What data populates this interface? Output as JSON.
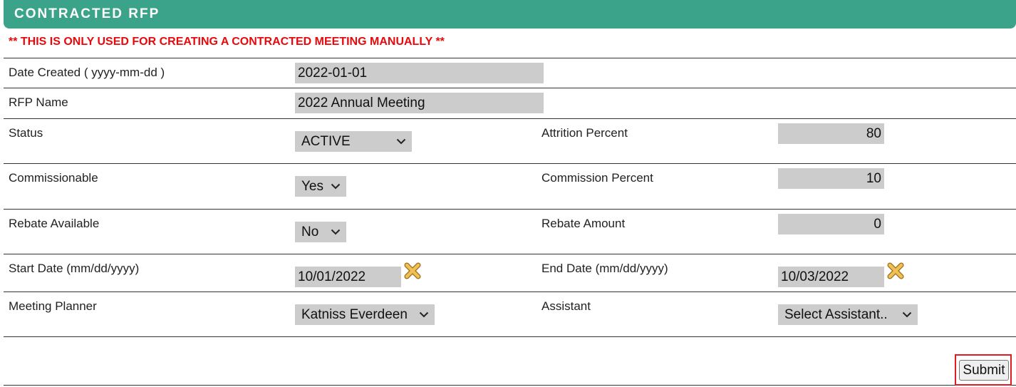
{
  "header": {
    "title": "CONTRACTED RFP"
  },
  "warning": "** THIS IS ONLY USED FOR CREATING A CONTRACTED MEETING MANUALLY **",
  "form": {
    "date_created": {
      "label": "Date Created ( yyyy-mm-dd )",
      "value": "2022-01-01"
    },
    "rfp_name": {
      "label": "RFP Name",
      "value": "2022 Annual Meeting"
    },
    "status": {
      "label": "Status",
      "value": "ACTIVE"
    },
    "attrition_percent": {
      "label": "Attrition Percent",
      "value": "80"
    },
    "commissionable": {
      "label": "Commissionable",
      "value": "Yes"
    },
    "commission_percent": {
      "label": "Commission Percent",
      "value": "10"
    },
    "rebate_available": {
      "label": "Rebate Available",
      "value": "No"
    },
    "rebate_amount": {
      "label": "Rebate Amount",
      "value": "0"
    },
    "start_date": {
      "label": "Start Date (mm/dd/yyyy)",
      "value": "10/01/2022"
    },
    "end_date": {
      "label": "End Date (mm/dd/yyyy)",
      "value": "10/03/2022"
    },
    "meeting_planner": {
      "label": "Meeting Planner",
      "value": "Katniss Everdeen"
    },
    "assistant": {
      "label": "Assistant",
      "value": "Select Assistant.."
    }
  },
  "submit_label": "Submit",
  "icons": {
    "chevron": "chevron-down-icon",
    "clear": "clear-x-icon"
  },
  "colors": {
    "header_bg": "#3ba38a",
    "warning_text": "#e8090c",
    "field_bg": "#cccccc",
    "submit_highlight": "#e01b22"
  }
}
